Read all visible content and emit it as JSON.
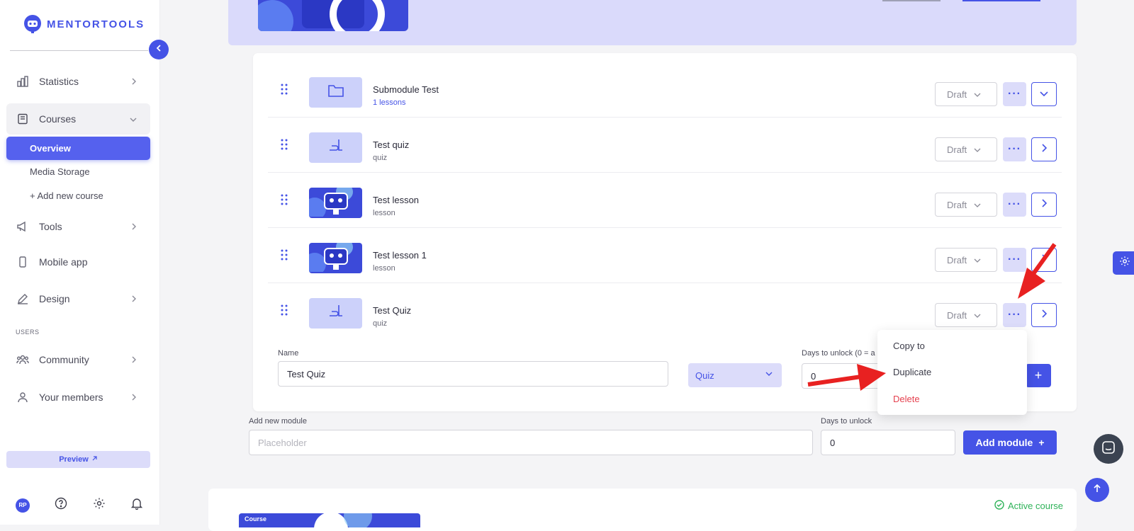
{
  "brand": {
    "name": "MENTORTOOLS"
  },
  "sidebar": {
    "items": [
      {
        "label": "Statistics",
        "icon": "bar-chart-icon"
      },
      {
        "label": "Courses",
        "icon": "book-icon"
      },
      {
        "label": "Tools",
        "icon": "megaphone-icon"
      },
      {
        "label": "Mobile app",
        "icon": "phone-icon"
      },
      {
        "label": "Design",
        "icon": "pencil-icon"
      },
      {
        "label": "Community",
        "icon": "people-icon"
      },
      {
        "label": "Your members",
        "icon": "user-icon"
      }
    ],
    "course_sub": [
      "Overview",
      "Media Storage",
      "+ Add new course"
    ],
    "section_users": "USERS",
    "preview": "Preview",
    "avatar_initials": "RP"
  },
  "lessons": [
    {
      "title": "Submodule Test",
      "sub": "1 lessons",
      "status": "Draft",
      "kind": "folder"
    },
    {
      "title": "Test quiz",
      "sub": "quiz",
      "status": "Draft",
      "kind": "quiz"
    },
    {
      "title": "Test lesson",
      "sub": "lesson",
      "status": "Draft",
      "kind": "image"
    },
    {
      "title": "Test lesson 1",
      "sub": "lesson",
      "status": "Draft",
      "kind": "image"
    },
    {
      "title": "Test Quiz",
      "sub": "quiz",
      "status": "Draft",
      "kind": "quiz"
    }
  ],
  "edit_form": {
    "name_label": "Name",
    "name_value": "Test Quiz",
    "type_value": "Quiz",
    "days_label": "Days to unlock (0 = a",
    "days_value": "0"
  },
  "context_menu": [
    "Copy to",
    "Duplicate",
    "Delete"
  ],
  "new_module": {
    "label": "Add new module",
    "placeholder": "Placeholder",
    "days_label": "Days to unlock",
    "days_value": "0",
    "button": "Add module"
  },
  "course_card": {
    "tag": "Course",
    "status": "Active course"
  },
  "colors": {
    "accent": "#4553e6",
    "danger": "#e5414f",
    "success": "#30b35a",
    "annotation": "#e82121"
  }
}
